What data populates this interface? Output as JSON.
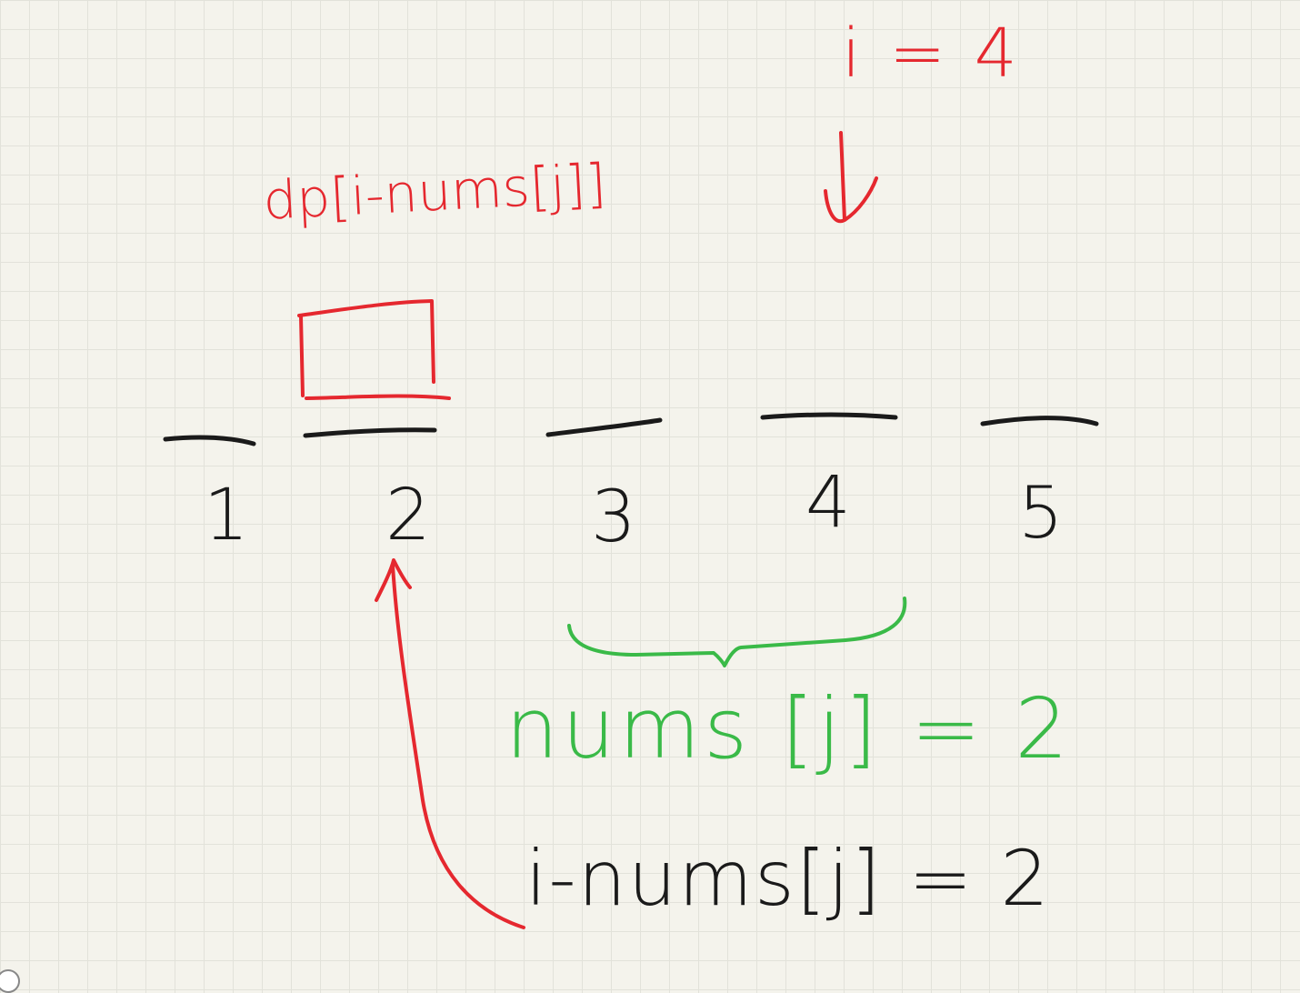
{
  "colors": {
    "red": "#e5282f",
    "green": "#3aba48",
    "black": "#1a1a1a",
    "paper": "#f4f3ec",
    "grid": "#e2e2da"
  },
  "labels": {
    "top_index": "i = 4",
    "dp_expr": "dp[i-nums[j]]",
    "nums_expr": "nums [j] = 2",
    "diff_expr": "i-nums[j] = 2"
  },
  "array": {
    "indices": [
      "1",
      "2",
      "3",
      "4",
      "5"
    ],
    "highlighted_index": "2",
    "pointer_index": "4"
  }
}
